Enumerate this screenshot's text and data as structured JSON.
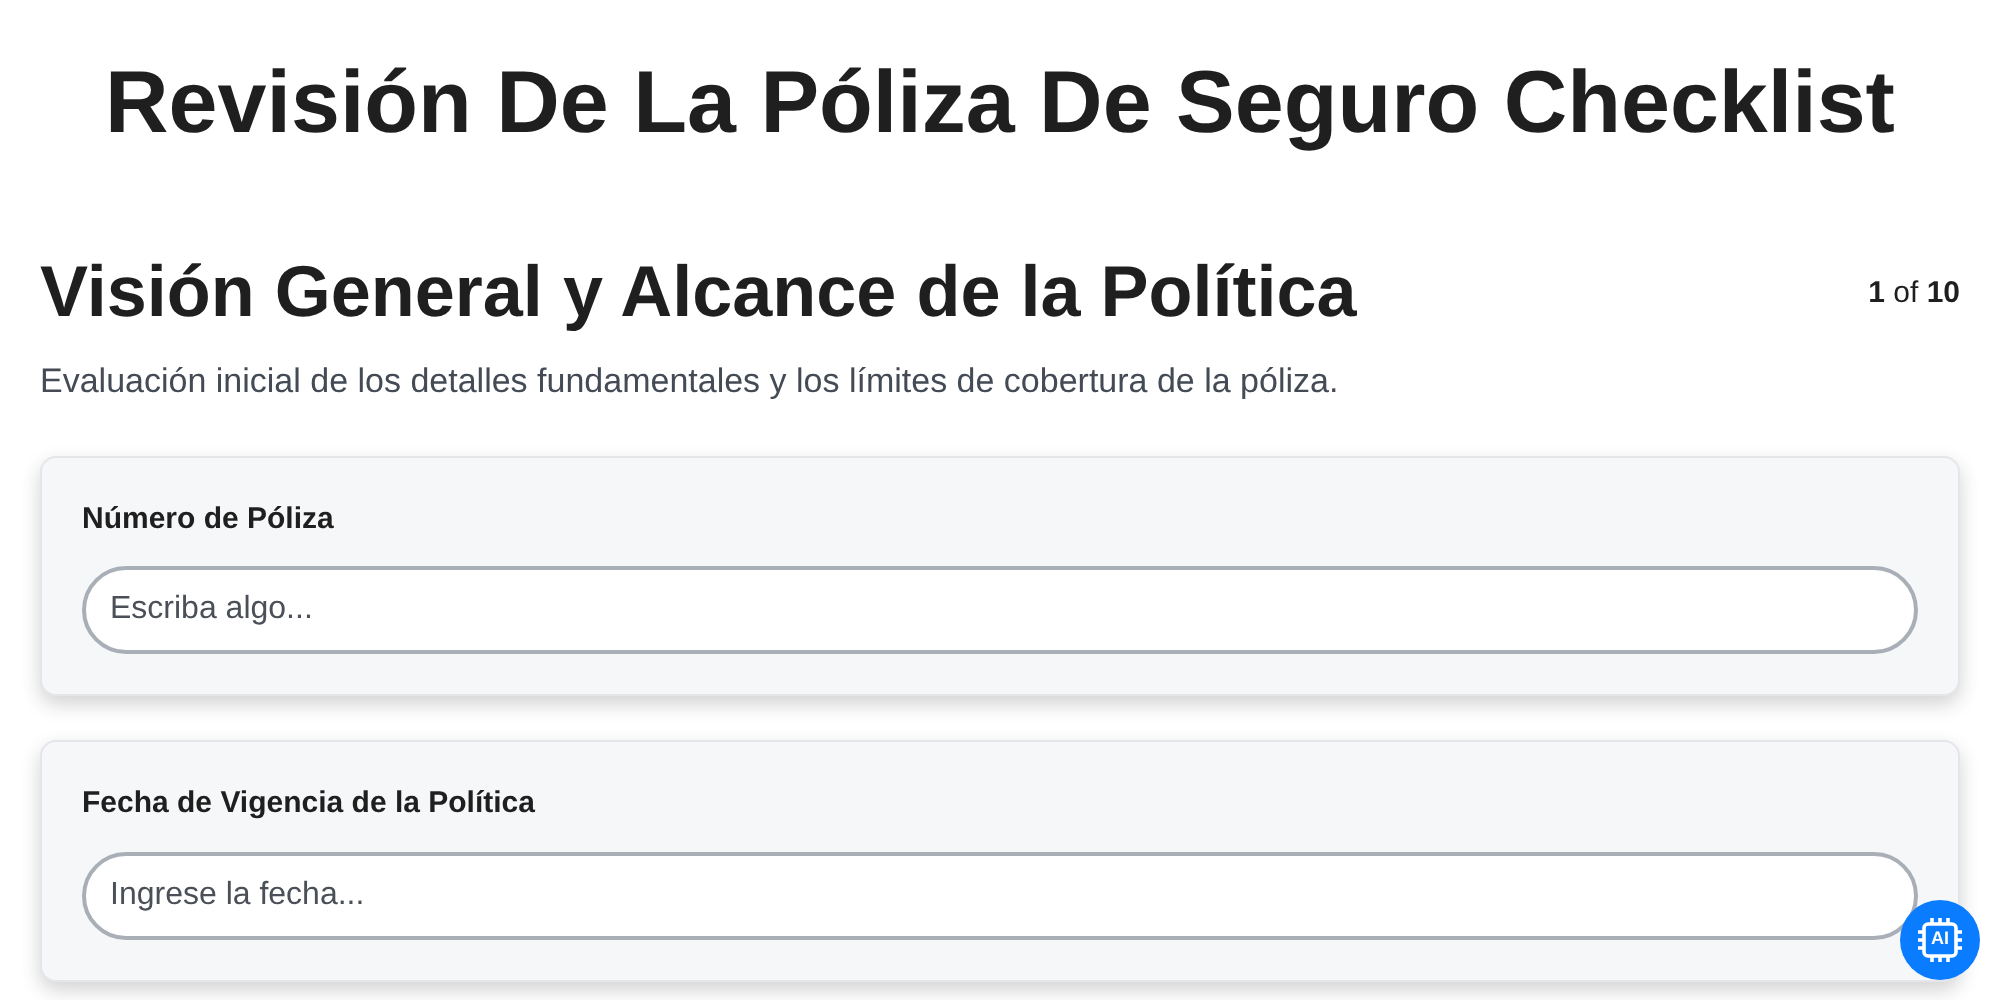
{
  "title": "Revisión De La Póliza De Seguro Checklist",
  "section": {
    "heading": "Visión General y Alcance de la Política",
    "counter": "**1** of **10**",
    "description": "Evaluación inicial de los detalles fundamentales y los límites de cobertura de la póliza."
  },
  "fields": [
    {
      "label": "Número de Póliza",
      "placeholder": "Escriba algo..."
    },
    {
      "label": "Fecha de Vigencia de la Política",
      "placeholder": "Ingrese la fecha..."
    }
  ],
  "assistant_button": {
    "label": "AI"
  }
}
